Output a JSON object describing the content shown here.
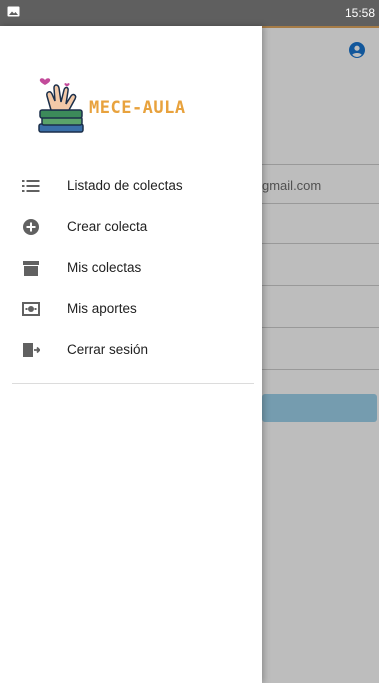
{
  "status_bar": {
    "time": "15:58",
    "notification_icon": "image-icon"
  },
  "background_app": {
    "account_icon": "account-circle-icon",
    "email_partial": "gmail.com",
    "accent_color": "#e0a860",
    "button_color": "#9ed3ec"
  },
  "drawer": {
    "logo_text": "MECE-AULA",
    "logo_color": "#e8a23d",
    "items": [
      {
        "label": "Listado de colectas",
        "icon": "list-icon"
      },
      {
        "label": "Crear colecta",
        "icon": "add-circle-icon"
      },
      {
        "label": "Mis colectas",
        "icon": "archive-box-icon"
      },
      {
        "label": "Mis aportes",
        "icon": "money-icon"
      },
      {
        "label": "Cerrar sesión",
        "icon": "logout-icon"
      }
    ]
  }
}
